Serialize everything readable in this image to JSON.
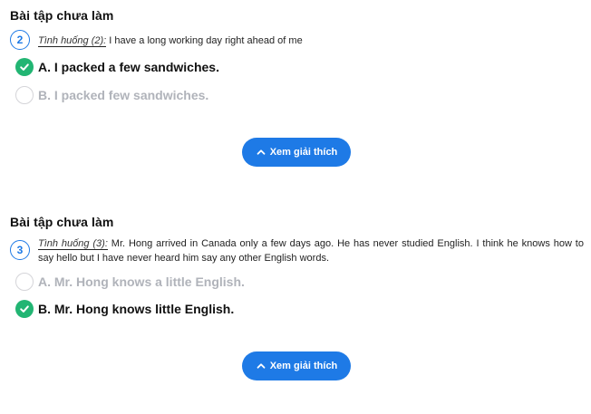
{
  "questions": [
    {
      "section_title": "Bài tập chưa làm",
      "number": "2",
      "situation_tag": "Tình huống (2):",
      "situation_text": " I have a long working day right ahead of me",
      "options": [
        {
          "text": "A. I packed a few sandwiches.",
          "state": "correct"
        },
        {
          "text": "B. I packed few sandwiches.",
          "state": "unselected"
        }
      ],
      "explain_label": "Xem giải thích"
    },
    {
      "section_title": "Bài tập chưa làm",
      "number": "3",
      "situation_tag": "Tình huống (3):",
      "situation_text": " Mr. Hong arrived in Canada only a few days ago. He has never studied English. I think he knows how to say hello but I have never heard him say any other English words.",
      "options": [
        {
          "text": "A. Mr. Hong knows a little English.",
          "state": "unselected"
        },
        {
          "text": "B. Mr. Hong knows little English.",
          "state": "correct"
        }
      ],
      "explain_label": "Xem giải thích"
    }
  ],
  "colors": {
    "accent": "#1e7ae6",
    "correct": "#22b573",
    "faded_text": "#b0b3ba"
  },
  "icons": {
    "correct": "check-icon",
    "explain": "chevron-up-icon"
  }
}
